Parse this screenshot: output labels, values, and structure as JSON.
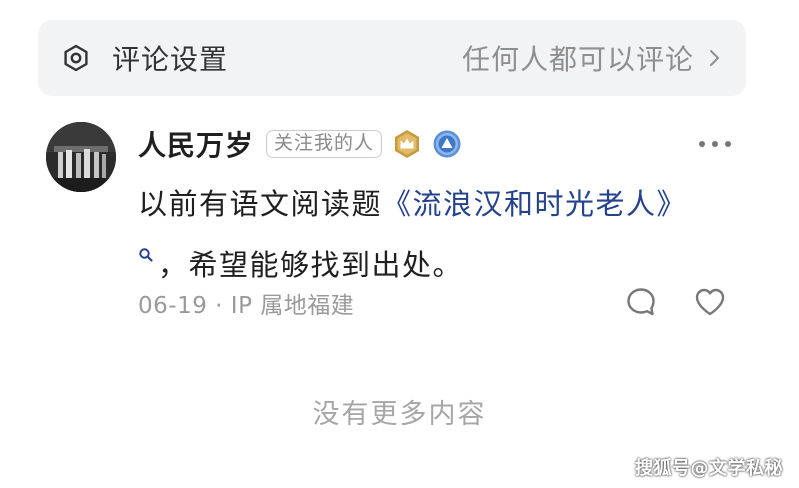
{
  "settings": {
    "label": "评论设置",
    "value": "任何人都可以评论",
    "icon": "settings-icon"
  },
  "comment": {
    "username": "人民万岁",
    "follow_badge": "关注我的人",
    "text_before": "以前有语文阅读题",
    "book_title": "《流浪汉和时光老人》",
    "text_after": "，希望能够找到出处。",
    "date": "06-19",
    "location": "IP 属地福建",
    "link_color": "#25428c"
  },
  "footer": {
    "no_more": "没有更多内容"
  },
  "watermark": "搜狐号@文学私秘"
}
